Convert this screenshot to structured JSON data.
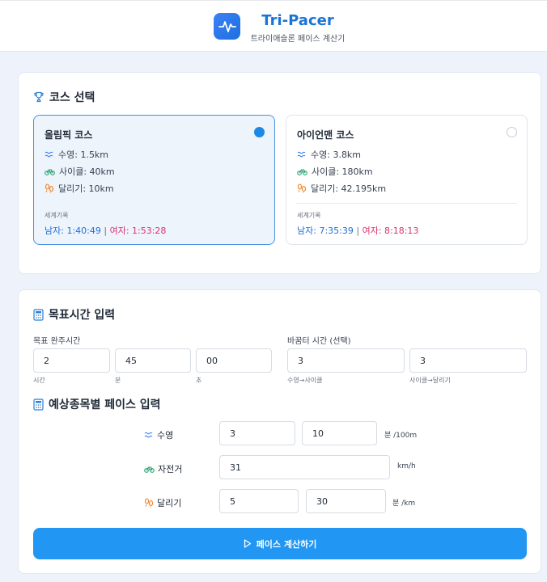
{
  "app": {
    "title": "Tri-Pacer",
    "subtitle": "트라이애슬론 페이스 계산기"
  },
  "course_section": {
    "title": "코스 선택",
    "courses": [
      {
        "name": "올림픽 코스",
        "selected": true,
        "swim": "수영: 1.5km",
        "bike": "사이클: 40km",
        "run": "달리기: 10km",
        "record_label": "세계기록",
        "men": "남자: 1:40:49",
        "separator": "|",
        "women": "여자: 1:53:28"
      },
      {
        "name": "아이언맨 코스",
        "selected": false,
        "swim": "수영: 3.8km",
        "bike": "사이클: 180km",
        "run": "달리기: 42.195km",
        "record_label": "세계기록",
        "men": "남자: 7:35:39",
        "separator": "|",
        "women": "여자: 8:18:13"
      }
    ]
  },
  "target_section": {
    "title": "목표시간 입력",
    "finish_label": "목표 완주시간",
    "hours": {
      "value": "2",
      "hint": "시간"
    },
    "minutes": {
      "value": "45",
      "hint": "분"
    },
    "seconds": {
      "value": "00",
      "hint": "초"
    },
    "transition_label": "바꿈터 시간 (선택)",
    "t1": {
      "value": "3",
      "hint": "수영→사이클"
    },
    "t2": {
      "value": "3",
      "hint": "사이클→달리기"
    }
  },
  "pace_section": {
    "title": "예상종목별 페이스 입력",
    "swim": {
      "label": "수영",
      "min": "3",
      "sec": "10",
      "unit": "분 /100m"
    },
    "bike": {
      "label": "자전거",
      "speed": "31",
      "unit": "km/h"
    },
    "run": {
      "label": "달리기",
      "min": "5",
      "sec": "30",
      "unit": "분 /km"
    }
  },
  "calculate_button": "페이스 계산하기",
  "colors": {
    "accent": "#2196f3",
    "brand": "#1a74d6",
    "men": "#1d6fd8",
    "women": "#d6336c",
    "swim_icon": "#3b82f6",
    "bike_icon": "#22a06b",
    "run_icon": "#f07c1b",
    "section_icon": "#2b7fd8"
  }
}
